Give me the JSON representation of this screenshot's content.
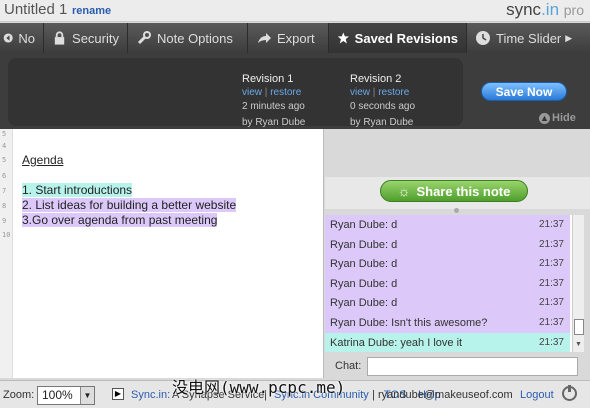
{
  "title": {
    "doc_name": "Untitled 1",
    "rename": "rename",
    "logo": {
      "brand": "sync",
      "tld": ".in",
      "edition": "pro"
    }
  },
  "toolbar": {
    "items": [
      {
        "label": "No",
        "icon": "circle-arrow-left-icon"
      },
      {
        "label": "Security",
        "icon": "lock-icon"
      },
      {
        "label": "Note Options",
        "icon": "wrench-icon"
      },
      {
        "label": "Export",
        "icon": "export-arrow-icon"
      },
      {
        "label": "Saved Revisions",
        "icon": "star-icon"
      },
      {
        "label": "Time Slider",
        "icon": "clock-icon"
      }
    ]
  },
  "revisions": [
    {
      "title": "Revision 1",
      "view": "view",
      "restore": "restore",
      "time": "2 minutes ago",
      "by": "by Ryan Dube"
    },
    {
      "title": "Revision 2",
      "view": "view",
      "restore": "restore",
      "time": "0 seconds ago",
      "by": "by Ryan Dube"
    }
  ],
  "save_now": "Save Now",
  "hide": "Hide",
  "editor": {
    "line_numbers": [
      "5",
      "4",
      "5",
      "6",
      "7",
      "8",
      "9",
      "10"
    ],
    "lines": [
      {
        "text": "Agenda",
        "style": "underline"
      },
      {
        "text": ""
      },
      {
        "text": "1. Start introductions",
        "style": "cyan"
      },
      {
        "text": "2. List ideas for building a better website",
        "style": "purple"
      },
      {
        "text": "3.Go over agenda from past meeting",
        "style": "purple"
      }
    ]
  },
  "share_button": "Share this note",
  "chat": {
    "messages": [
      {
        "text": "Ryan Dube: d",
        "time": "21:37",
        "color": "purple"
      },
      {
        "text": "Ryan Dube: d",
        "time": "21:37",
        "color": "purple"
      },
      {
        "text": "Ryan Dube: d",
        "time": "21:37",
        "color": "purple"
      },
      {
        "text": "Ryan Dube: d",
        "time": "21:37",
        "color": "purple"
      },
      {
        "text": "Ryan Dube: d",
        "time": "21:37",
        "color": "purple"
      },
      {
        "text": "Ryan Dube: Isn't this awesome?",
        "time": "21:37",
        "color": "purple"
      },
      {
        "text": "Katrina Dube: yeah I love it",
        "time": "21:37",
        "color": "cyan"
      }
    ],
    "input_label": "Chat:",
    "input_value": ""
  },
  "footer": {
    "zoom_label": "Zoom:",
    "zoom_value": "100%",
    "sync_link": "Sync.in:",
    "synapse": "A Synapse Service",
    "community": "Sync.in Community",
    "tos": "TOS",
    "help": "Help",
    "user": "ryandube@makeuseof.com",
    "logout": "Logout"
  },
  "watermark": "没电网(www.pcpc.me)",
  "colors": {
    "highlight_cyan": "#b7f3ea",
    "highlight_purple": "#dcc9f9",
    "accent_blue": "#2a7ad8",
    "share_green": "#4f9f2c"
  }
}
